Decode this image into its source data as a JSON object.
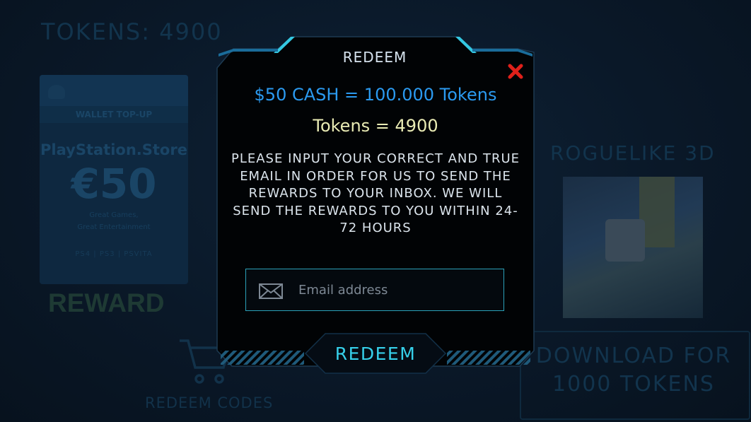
{
  "background": {
    "tokens_label": "TOKENS: 4900",
    "reward_card": {
      "wallet_label": "WALLET TOP-UP",
      "store_name": "PlayStation.Store",
      "amount": "€50",
      "tagline_1": "Great Games,",
      "tagline_2": "Great Entertainment",
      "platforms": "PS4 | PS3 | PSVITA"
    },
    "reward_label": "REWARD",
    "redeem_codes_label": "REDEEM CODES",
    "game_title": "ROGUELIKE 3D",
    "download_line_1": "DOWNLOAD FOR",
    "download_line_2": "1000 TOKENS"
  },
  "modal": {
    "title": "REDEEM",
    "rate_text": "$50 CASH = 100.000 Tokens",
    "tokens_text": "Tokens = 4900",
    "instructions": "PLEASE INPUT YOUR CORRECT AND TRUE EMAIL IN ORDER FOR US TO SEND THE REWARDS TO YOUR INBOX. WE WILL SEND THE REWARDS TO YOU WITHIN 24-72 HOURS",
    "email_value": "",
    "email_placeholder": "Email address",
    "redeem_button_label": "REDEEM"
  },
  "colors": {
    "accent_cyan": "#36d0ea",
    "rate_blue": "#2b9af0",
    "tokens_yellow": "#e9ebb4",
    "close_red": "#e0201a"
  },
  "icons": [
    "close-icon",
    "mail-icon",
    "cart-icon",
    "playstation-icon"
  ]
}
